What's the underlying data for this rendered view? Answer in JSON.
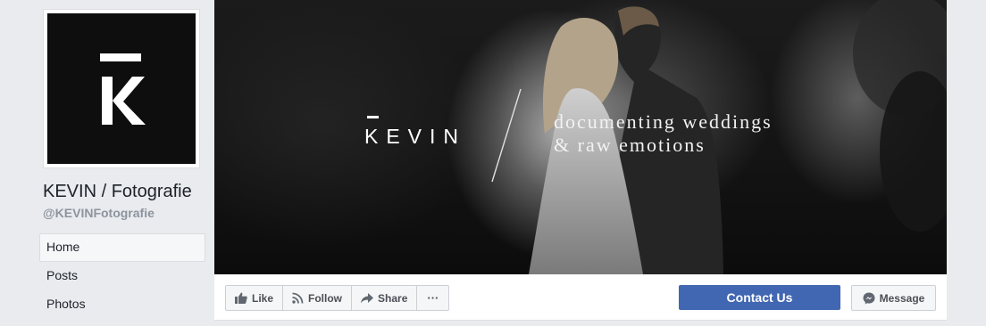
{
  "page": {
    "name": "KEVIN / Fotografie",
    "handle": "@KEVINFotografie",
    "profile_logo_letter": "K"
  },
  "nav": {
    "items": [
      {
        "label": "Home",
        "active": true
      },
      {
        "label": "Posts",
        "active": false
      },
      {
        "label": "Photos",
        "active": false
      }
    ]
  },
  "cover": {
    "brand": "KEVIN",
    "tagline_line1": "documenting weddings",
    "tagline_line2": "& raw emotions"
  },
  "actions": {
    "like_label": "Like",
    "follow_label": "Follow",
    "share_label": "Share",
    "more_label": "···",
    "contact_label": "Contact Us",
    "message_label": "Message"
  },
  "colors": {
    "background": "#e9ebee",
    "brand_blue": "#4267b2",
    "text_dark": "#1d2129",
    "text_muted": "#8d949e",
    "button_text": "#4b4f56"
  },
  "icons": {
    "like": "thumbs-up-icon",
    "follow": "rss-icon",
    "share": "share-arrow-icon",
    "message": "messenger-icon"
  }
}
